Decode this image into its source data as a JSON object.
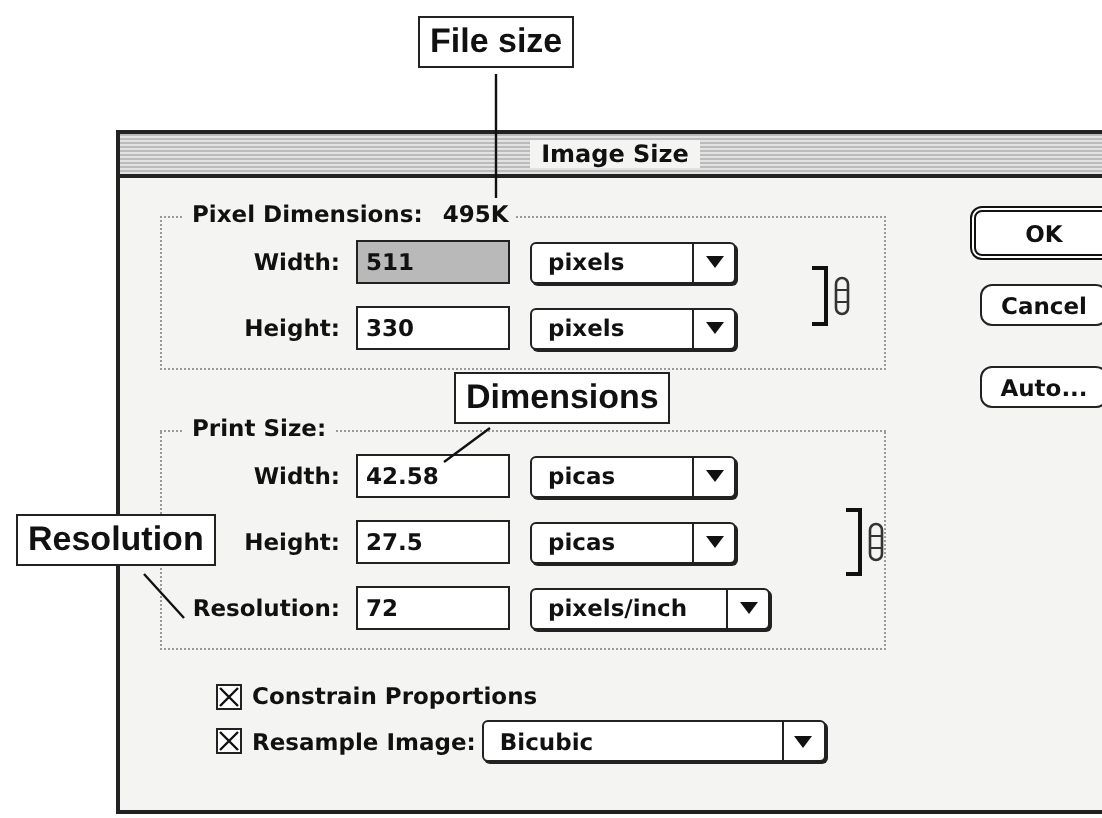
{
  "callouts": [
    {
      "kind": "top",
      "text": "File size"
    },
    {
      "kind": "middle",
      "text": "Dimensions"
    },
    {
      "kind": "left",
      "text": "Resolution"
    }
  ],
  "dialog": {
    "title": "Image Size",
    "pixel_dimensions": {
      "label": "Pixel Dimensions:",
      "value": "495K",
      "linked": true,
      "rows": [
        {
          "label": "Width:",
          "value": "511",
          "selected": true,
          "unit": "pixels"
        },
        {
          "label": "Height:",
          "value": "330",
          "selected": false,
          "unit": "pixels"
        }
      ]
    },
    "print_size": {
      "label": "Print Size:",
      "linked": true,
      "rows": [
        {
          "label": "Width:",
          "value": "42.58",
          "selected": false,
          "unit": "picas"
        },
        {
          "label": "Height:",
          "value": "27.5",
          "selected": false,
          "unit": "picas"
        },
        {
          "label": "Resolution:",
          "value": "72",
          "selected": false,
          "unit": "pixels/inch"
        }
      ]
    },
    "buttons": [
      {
        "label": "OK",
        "default": true
      },
      {
        "label": "Cancel",
        "default": false
      },
      {
        "label": "Auto...",
        "default": false
      }
    ],
    "options": [
      {
        "label": "Constrain Proportions",
        "checked": true
      },
      {
        "label": "Resample Image:",
        "checked": true,
        "select": "Bicubic"
      }
    ]
  }
}
